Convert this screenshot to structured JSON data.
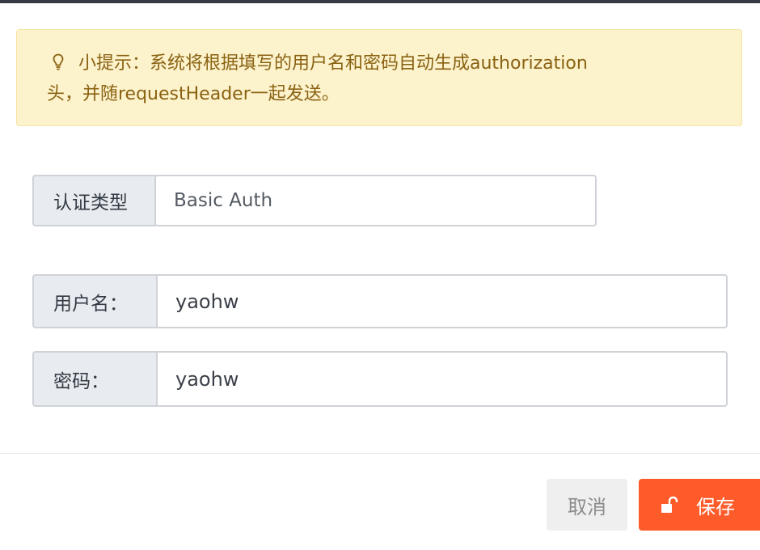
{
  "tip": {
    "icon": "lightbulb-icon",
    "line1": "小提示：系统将根据填写的用户名和密码自动生成authorization",
    "line2": "头，并随requestHeader一起发送。"
  },
  "form": {
    "auth_type": {
      "label": "认证类型",
      "value": "Basic Auth"
    },
    "username": {
      "label": "用户名：",
      "value": "yaohw"
    },
    "password": {
      "label": "密码：",
      "value": "yaohw"
    }
  },
  "footer": {
    "cancel_label": "取消",
    "save_label": "保存",
    "save_icon": "unlock-icon"
  },
  "colors": {
    "accent": "#fd5c2a",
    "tip_bg": "#fcf2cc",
    "tip_text": "#8a6212"
  }
}
